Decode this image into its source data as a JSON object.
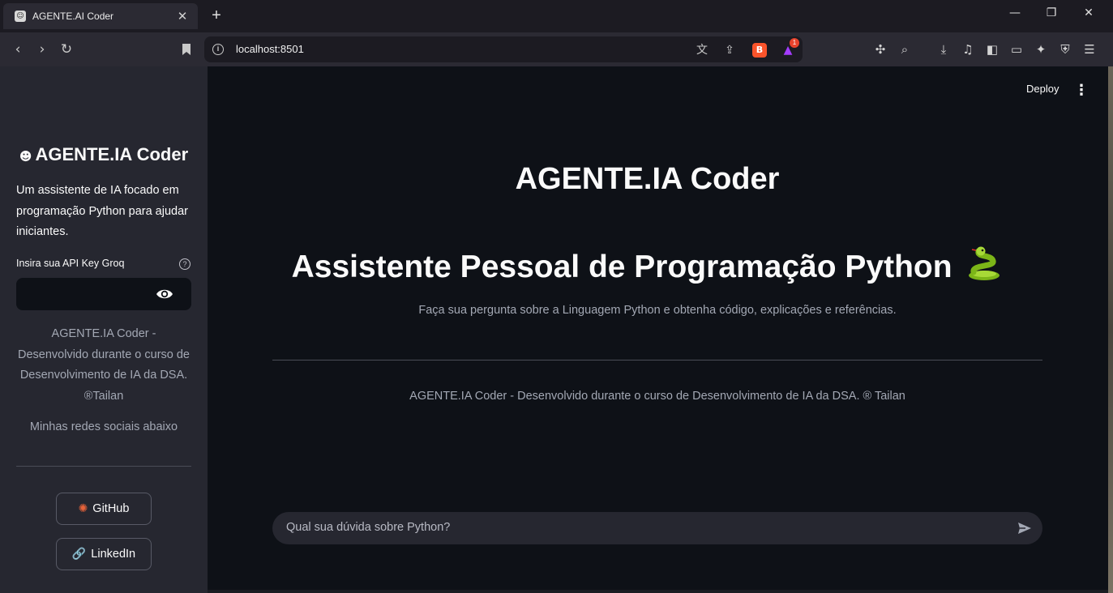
{
  "browser": {
    "tab_title": "AGENTE.AI Coder",
    "tab_close": "✕",
    "new_tab": "+",
    "url": "localhost:8501",
    "notification_count": "1",
    "window": {
      "minimize": "—",
      "restore": "❐",
      "close": "✕"
    }
  },
  "header": {
    "deploy_label": "Deploy",
    "menu_icon": "⋮"
  },
  "sidebar": {
    "title": "AGENTE.IA Coder",
    "description": "Um assistente de IA focado em programação Python para ajudar iniciantes.",
    "api_key_label": "Insira sua API Key Groq",
    "api_key_value": "",
    "help": "?",
    "credit": "AGENTE.IA Coder - Desenvolvido durante o curso de Desenvolvimento de IA da DSA. ®Tailan",
    "social_caption": "Minhas redes sociais abaixo",
    "buttons": [
      {
        "label": "GitHub",
        "icon": "octopus-icon"
      },
      {
        "label": "LinkedIn",
        "icon": "link-icon"
      }
    ]
  },
  "main": {
    "title": "AGENTE.IA Coder",
    "heading": "Assistente Pessoal de Programação Python",
    "subtitle": "Faça sua pergunta sobre a Linguagem Python e obtenha código, explicações e referências.",
    "footer": "AGENTE.IA Coder - Desenvolvido durante o curso de Desenvolvimento de IA da DSA. ® Tailan",
    "chat_placeholder": "Qual sua dúvida sobre Python?"
  },
  "colors": {
    "app_bg": "#0e1117",
    "sidebar_bg": "#262730",
    "text_primary": "#fafafa",
    "text_muted": "#a3a8b4",
    "browser_bg": "#2b2a33"
  }
}
